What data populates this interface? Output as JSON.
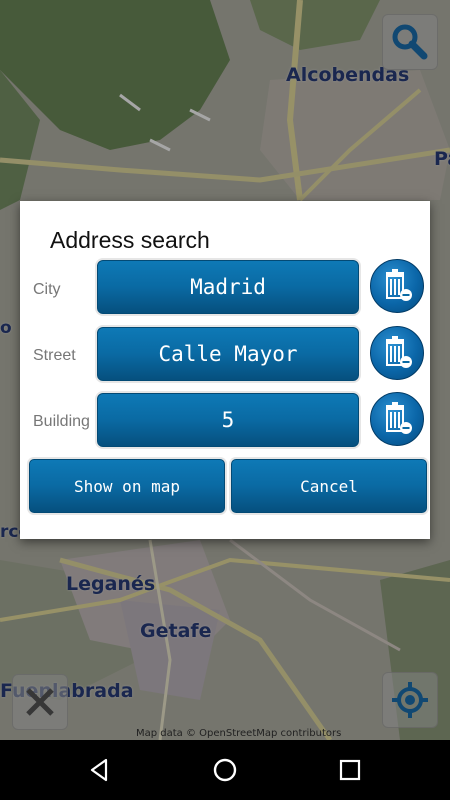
{
  "map": {
    "labels": {
      "alcobendas": "Alcobendas",
      "pa": "Pa",
      "o": "o",
      "rco": "rco",
      "leganes": "Leganés",
      "getafe": "Getafe",
      "fuenlabrada": "Fuenlabrada"
    },
    "attribution": "Map data © OpenStreetMap contributors",
    "colors": {
      "park": "#6f8a5c",
      "urban": "#b2b2a6",
      "road": "#e8e0b0"
    }
  },
  "dialog": {
    "title": "Address search",
    "rows": [
      {
        "label": "City",
        "value": "Madrid"
      },
      {
        "label": "Street",
        "value": "Calle Mayor"
      },
      {
        "label": "Building",
        "value": "5"
      }
    ],
    "show_on_map_label": "Show on map",
    "cancel_label": "Cancel",
    "accent_color": "#0a6aa3"
  },
  "icons": {
    "search": "search-icon",
    "trash": "trash-icon",
    "close": "close-icon",
    "locate": "locate-icon",
    "back": "back-icon",
    "home": "home-icon",
    "recents": "recents-icon"
  }
}
